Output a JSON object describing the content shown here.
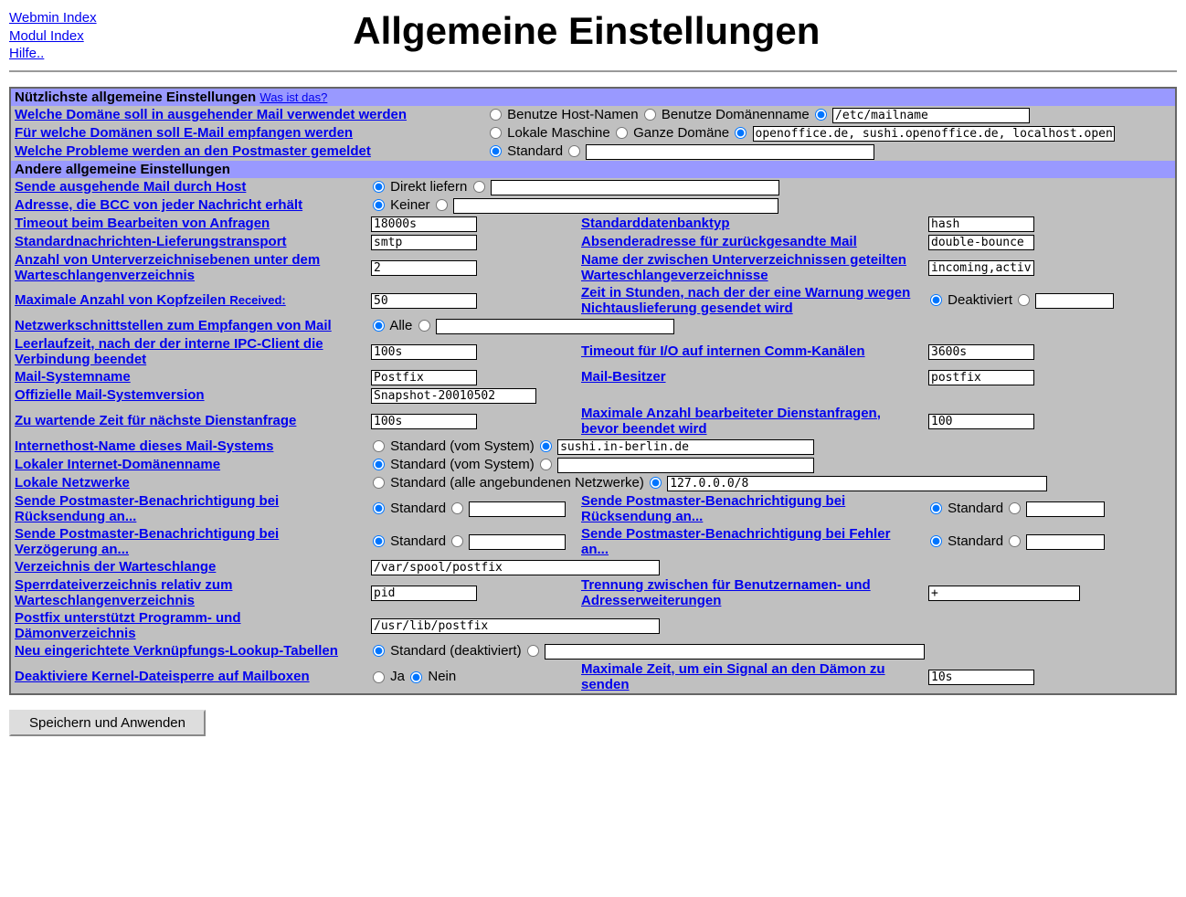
{
  "nav": {
    "webmin": "Webmin Index",
    "modul": "Modul Index",
    "hilfe": "Hilfe.."
  },
  "title": "Allgemeine Einstellungen",
  "sec1_title": "Nützlichste allgemeine Einstellungen",
  "sec1_whatis": "Was ist das?",
  "sec2_title": "Andere allgemeine Einstellungen",
  "r1": {
    "label": "Welche Domäne soll in ausgehender Mail verwendet werden",
    "opt1": "Benutze Host-Namen",
    "opt2": "Benutze Domänenname",
    "val": "/etc/mailname"
  },
  "r2": {
    "label": "Für welche Domänen soll E-Mail empfangen werden",
    "opt1": "Lokale Maschine",
    "opt2": "Ganze Domäne",
    "val": "openoffice.de, sushi.openoffice.de, localhost.openoffice.de"
  },
  "r3": {
    "label": "Welche Probleme werden an den Postmaster gemeldet",
    "opt1": "Standard"
  },
  "r4": {
    "label": "Sende ausgehende Mail durch Host",
    "opt1": "Direkt liefern"
  },
  "r5": {
    "label": "Adresse, die BCC von jeder Nachricht erhält",
    "opt1": "Keiner"
  },
  "r6": {
    "l1": "Timeout beim Bearbeiten von Anfragen",
    "v1": "18000s",
    "l2": "Standarddatenbanktyp",
    "v2": "hash"
  },
  "r7": {
    "l1": "Standardnachrichten-Lieferungstransport",
    "v1": "smtp",
    "l2": "Absenderadresse für zurückgesandte Mail",
    "v2": "double-bounce"
  },
  "r8": {
    "l1": "Anzahl von Unterverzeichnisebenen unter dem Warteschlangenverzeichnis",
    "v1": "2",
    "l2": "Name der zwischen Unterverzeichnissen geteilten Warteschlangeverzeichnisse",
    "v2": "incoming,active,"
  },
  "r9": {
    "l1a": "Maximale Anzahl von Kopfzeilen ",
    "l1b": "Received:",
    "v1": "50",
    "l2": "Zeit in Stunden, nach der der eine Warnung wegen Nichtauslieferung gesendet wird",
    "opt": "Deaktiviert"
  },
  "r10": {
    "label": "Netzwerkschnittstellen zum Empfangen von Mail",
    "opt1": "Alle"
  },
  "r11": {
    "l1": "Leerlaufzeit, nach der der interne IPC-Client die Verbindung beendet",
    "v1": "100s",
    "l2": "Timeout für I/O auf internen Comm-Kanälen",
    "v2": "3600s"
  },
  "r12": {
    "l1": "Mail-Systemname",
    "v1": "Postfix",
    "l2": "Mail-Besitzer",
    "v2": "postfix"
  },
  "r13": {
    "l1": "Offizielle Mail-Systemversion",
    "v1": "Snapshot-20010502"
  },
  "r14": {
    "l1": "Zu wartende Zeit für nächste Dienstanfrage",
    "v1": "100s",
    "l2": "Maximale Anzahl bearbeiteter Dienstanfragen, bevor beendet wird",
    "v2": "100"
  },
  "r15": {
    "label": "Internethost-Name dieses Mail-Systems",
    "opt1": "Standard (vom System)",
    "val": "sushi.in-berlin.de"
  },
  "r16": {
    "label": "Lokaler Internet-Domänenname",
    "opt1": "Standard (vom System)"
  },
  "r17": {
    "label": "Lokale Netzwerke",
    "opt1": "Standard (alle angebundenen Netzwerke)",
    "val": "127.0.0.0/8"
  },
  "r18": {
    "l1": "Sende Postmaster-Benachrichtigung bei Rücksendung an...",
    "opt": "Standard",
    "l2": "Sende Postmaster-Benachrichtigung bei Rücksendung an..."
  },
  "r19": {
    "l1": "Sende Postmaster-Benachrichtigung bei Verzögerung an...",
    "opt": "Standard",
    "l2": "Sende Postmaster-Benachrichtigung bei Fehler an..."
  },
  "r20": {
    "l1": "Verzeichnis der Warteschlange",
    "v1": "/var/spool/postfix"
  },
  "r21": {
    "l1": "Sperrdateiverzeichnis relativ zum Warteschlangenverzeichnis",
    "v1": "pid",
    "l2": "Trennung zwischen für Benutzernamen- und Adresserweiterungen",
    "v2": "+"
  },
  "r22": {
    "l1": "Postfix unterstützt Programm- und Dämonverzeichnis",
    "v1": "/usr/lib/postfix"
  },
  "r23": {
    "label": "Neu eingerichtete Verknüpfungs-Lookup-Tabellen",
    "opt1": "Standard (deaktiviert)"
  },
  "r24": {
    "l1": "Deaktiviere Kernel-Dateisperre auf Mailboxen",
    "opt1": "Ja",
    "opt2": "Nein",
    "l2": "Maximale Zeit, um ein Signal an den Dämon zu senden",
    "v2": "10s"
  },
  "submit": "Speichern und Anwenden"
}
